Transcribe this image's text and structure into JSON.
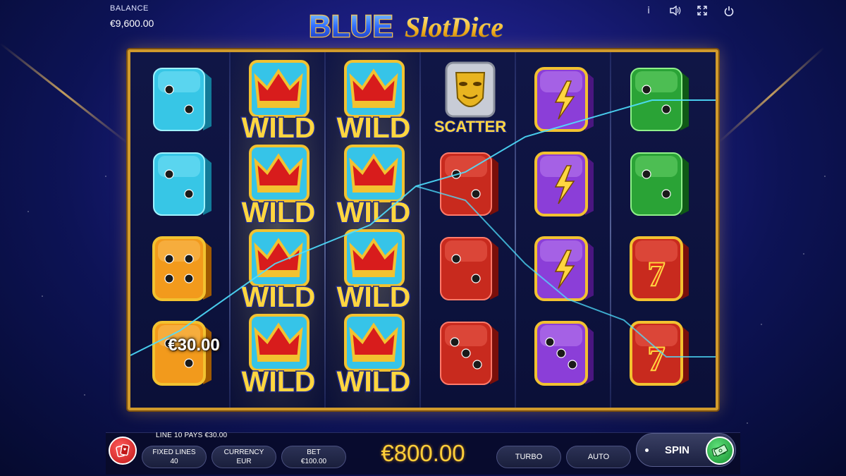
{
  "header": {
    "balance_label": "BALANCE",
    "balance_value": "€9,600.00",
    "logo_word_1": "BLUE",
    "logo_word_2": "SlotDice",
    "icons": [
      "info-icon",
      "sound-icon",
      "fullscreen-icon",
      "power-icon"
    ],
    "info_glyph": "i"
  },
  "reels": {
    "columns": [
      [
        "cyan-die-2",
        "cyan-die-2",
        "orange-die-4",
        "orange-die-2"
      ],
      [
        "wild",
        "wild",
        "wild",
        "wild"
      ],
      [
        "wild",
        "wild",
        "wild",
        "wild"
      ],
      [
        "scatter",
        "red-die-2",
        "red-die-2",
        "red-die-3"
      ],
      [
        "purple-bolt",
        "purple-bolt",
        "purple-bolt",
        "purple-die-3"
      ],
      [
        "green-die-2",
        "green-die-2",
        "red-seven",
        "red-seven"
      ]
    ],
    "wild_label": "WILD",
    "scatter_label": "SCATTER",
    "win_amount": "€30.00"
  },
  "colors": {
    "frame_gold": "#d09a2c",
    "wild_yellow": "#ffd640",
    "stake_yellow": "#ffcf3a",
    "payline_cyan": "#4fe0ff",
    "spin_green": "#14902e",
    "gamble_red": "#c01818"
  },
  "controls": {
    "line_pays": "LINE 10 PAYS €30.00",
    "fixed_lines_label": "FIXED LINES",
    "fixed_lines_value": "40",
    "currency_label": "CURRENCY",
    "currency_value": "EUR",
    "bet_label": "BET",
    "bet_value": "€100.00",
    "stake": "€800.00",
    "turbo_label": "TURBO",
    "auto_label": "AUTO",
    "spin_label": "SPIN"
  }
}
